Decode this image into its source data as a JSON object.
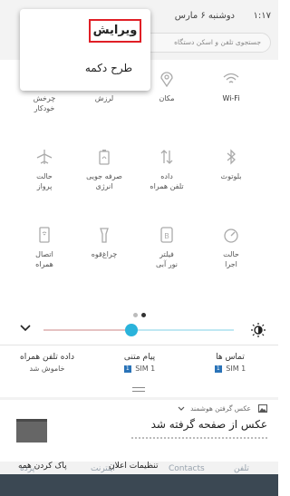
{
  "status": {
    "time": "۱:۱۷",
    "date": "دوشنبه ۶ مارس"
  },
  "search": {
    "placeholder": "جستجوی تلفن و اسکن دستگاه"
  },
  "popup": {
    "edit_label": "ویرایش",
    "button_layout_label": "طرح دکمه"
  },
  "tiles": [
    {
      "label": "Wi-Fi",
      "icon": "wifi-icon",
      "active": true
    },
    {
      "label": "مکان",
      "icon": "location-icon",
      "active": false
    },
    {
      "label": "لرزش",
      "icon": "vibrate-icon",
      "active": false
    },
    {
      "label": "چرخش\nخودکار",
      "icon": "rotate-icon",
      "active": false
    },
    {
      "label": "بلوتوث",
      "icon": "bluetooth-icon",
      "active": false
    },
    {
      "label": "داده\nتلفن همراه",
      "icon": "mobile-data-icon",
      "active": false
    },
    {
      "label": "صرفه جویی\nانرژی",
      "icon": "battery-saver-icon",
      "active": false
    },
    {
      "label": "حالت\nپرواز",
      "icon": "airplane-icon",
      "active": false
    },
    {
      "label": "حالت\nاجرا",
      "icon": "performance-mode-icon",
      "active": false
    },
    {
      "label": "فیلتر\nنور آبی",
      "icon": "blue-light-filter-icon",
      "active": false
    },
    {
      "label": "چراغ‌قوه",
      "icon": "flashlight-icon",
      "active": false
    },
    {
      "label": "اتصال\nهمراه",
      "icon": "mobile-hotspot-icon",
      "active": false
    }
  ],
  "pager": {
    "count": 2,
    "active_index": 1
  },
  "brightness": {
    "level": 0.46
  },
  "sims": [
    {
      "title": "تماس ها",
      "sim": "SIM 1",
      "badge": "1"
    },
    {
      "title": "پیام متنی",
      "sim": "SIM 1",
      "badge": "1"
    },
    {
      "title": "داده تلفن همراه",
      "sim": "خاموش شد"
    }
  ],
  "notification": {
    "app": "عکس گرفتن هوشمند",
    "title": "عکس از صفحه گرفته شد"
  },
  "actions": {
    "settings_label": "تنظیمات اعلان",
    "clear_label": "پاک کردن همه"
  },
  "dock": [
    "تلفن",
    "Contacts",
    "اینترنت",
    "پرده"
  ],
  "colors": {
    "accent": "#2ab3db",
    "highlight_border": "#e01f26",
    "sim_badge": "#2a73b8",
    "bottom_band": "#3b4853"
  }
}
